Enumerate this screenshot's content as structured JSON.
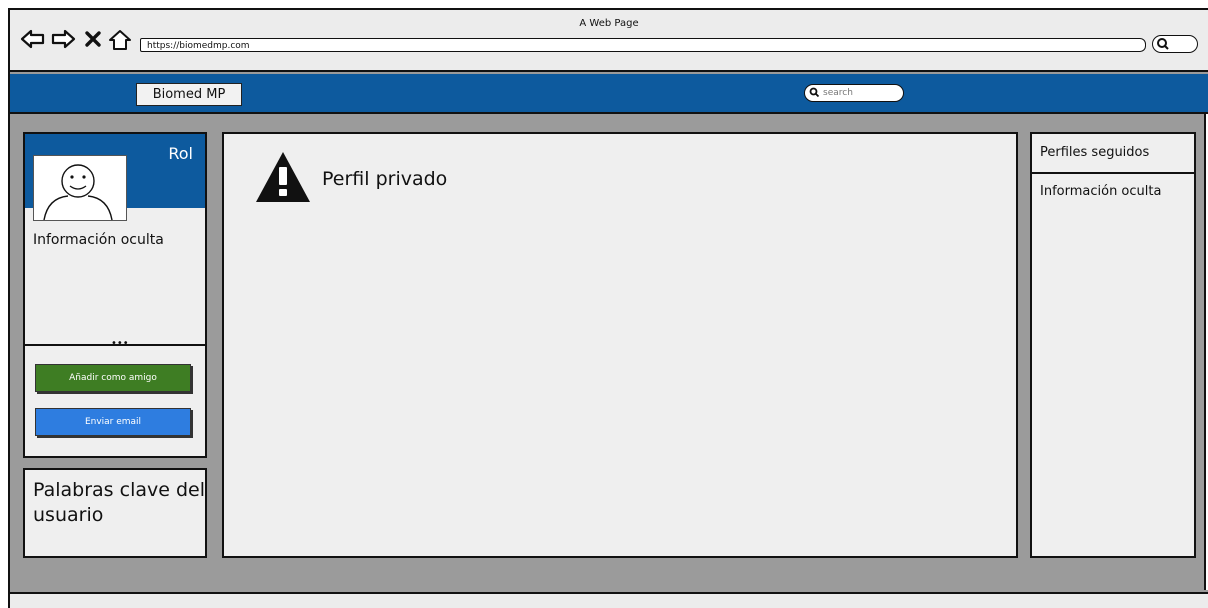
{
  "window": {
    "title": "A Web Page"
  },
  "browser": {
    "url": "https://biomedmp.com"
  },
  "navbar": {
    "brand": "Biomed MP",
    "search_placeholder": "search"
  },
  "profile": {
    "role": "Rol",
    "hidden_info": "Información oculta",
    "add_friend_label": "Añadir como amigo",
    "send_email_label": "Enviar email",
    "keywords_label": "Palabras clave del usuario"
  },
  "main": {
    "private_label": "Perfil privado"
  },
  "following": {
    "title": "Perfiles seguidos",
    "hidden_info": "Información oculta"
  },
  "colors": {
    "navbar": "#0d5a9e",
    "add_friend_button": "#3e7d23",
    "send_email_button": "#2e7de0"
  },
  "icons": [
    "back-icon",
    "forward-icon",
    "close-icon",
    "home-icon",
    "search-icon",
    "warning-icon",
    "avatar-icon"
  ]
}
